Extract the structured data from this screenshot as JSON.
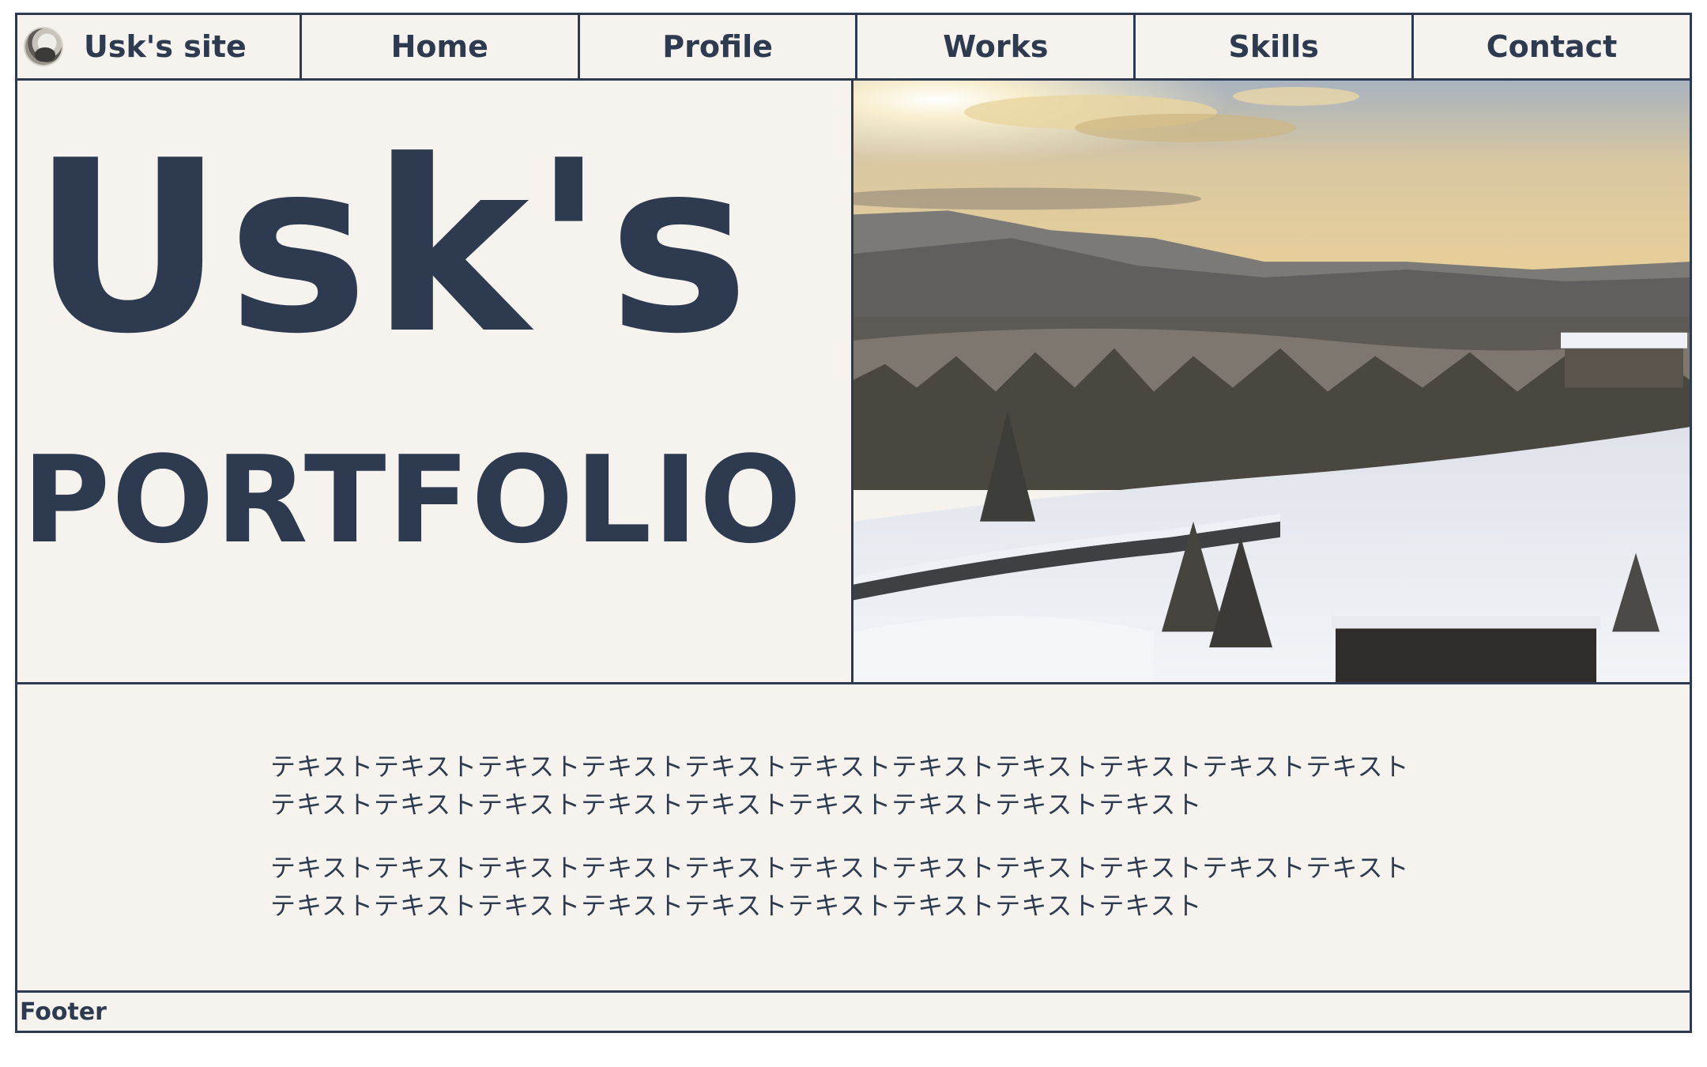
{
  "nav": {
    "brand_label": "Usk's site",
    "items": [
      {
        "label": "Home"
      },
      {
        "label": "Profile"
      },
      {
        "label": "Works"
      },
      {
        "label": "Skills"
      },
      {
        "label": "Contact"
      }
    ]
  },
  "hero": {
    "title": "Usk's",
    "subtitle": "PORTFOLIO"
  },
  "content": {
    "paragraphs": [
      "テキストテキストテキストテキストテキストテキストテキストテキストテキストテキストテキストテキストテキストテキストテキストテキストテキストテキストテキストテキスト",
      "テキストテキストテキストテキストテキストテキストテキストテキストテキストテキストテキストテキストテキストテキストテキストテキストテキストテキストテキストテキスト"
    ]
  },
  "footer": {
    "label": "Footer"
  },
  "colors": {
    "text": "#2d3a4f",
    "background": "#f6f3ee"
  }
}
